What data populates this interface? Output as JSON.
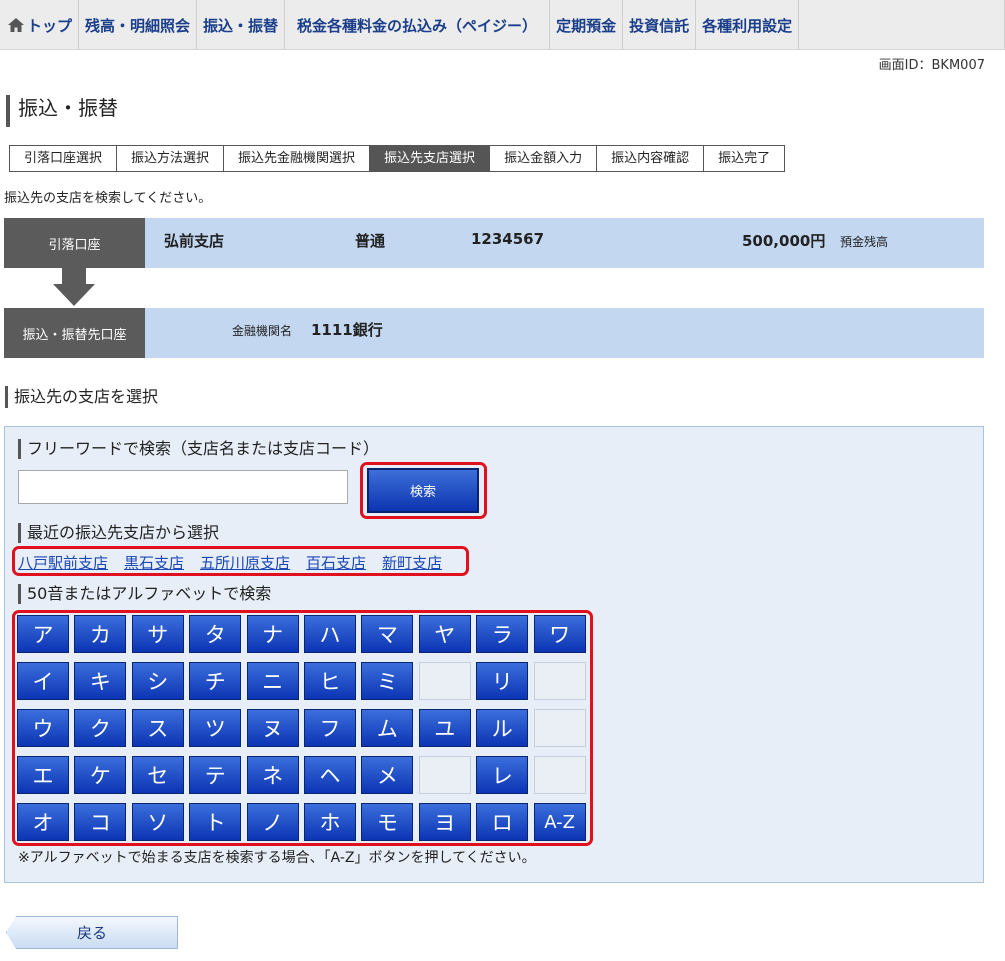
{
  "nav": {
    "items": [
      "トップ",
      "残高・明細照会",
      "振込・振替",
      "税金各種料金の払込み（ペイジー）",
      "定期預金",
      "投資信託",
      "各種利用設定"
    ]
  },
  "screen_id": "画面ID：BKM007",
  "page_title": "振込・振替",
  "steps": [
    "引落口座選択",
    "振込方法選択",
    "振込先金融機関選択",
    "振込先支店選択",
    "振込金額入力",
    "振込内容確認",
    "振込完了"
  ],
  "instruction": "振込先の支店を検索してください。",
  "debit_account": {
    "label": "引落口座",
    "branch": "弘前支店",
    "type": "普通",
    "number": "1234567",
    "balance": "500,000円",
    "balance_label": "預金残高"
  },
  "target_account": {
    "label": "振込・振替先口座",
    "bank_label": "金融機関名",
    "bank_name": "1111銀行"
  },
  "section_title": "振込先の支店を選択",
  "free_search": {
    "title": "フリーワードで検索（支店名または支店コード）",
    "value": "",
    "button": "検索"
  },
  "recent": {
    "title": "最近の振込先支店から選択",
    "branches": [
      "八戸駅前支店",
      "黒石支店",
      "五所川原支店",
      "百石支店",
      "新町支店"
    ]
  },
  "kana": {
    "title": "50音またはアルファベットで検索",
    "rows": [
      [
        "ア",
        "カ",
        "サ",
        "タ",
        "ナ",
        "ハ",
        "マ",
        "ヤ",
        "ラ",
        "ワ"
      ],
      [
        "イ",
        "キ",
        "シ",
        "チ",
        "ニ",
        "ヒ",
        "ミ",
        "",
        "リ",
        ""
      ],
      [
        "ウ",
        "ク",
        "ス",
        "ツ",
        "ヌ",
        "フ",
        "ム",
        "ユ",
        "ル",
        ""
      ],
      [
        "エ",
        "ケ",
        "セ",
        "テ",
        "ネ",
        "ヘ",
        "メ",
        "",
        "レ",
        ""
      ],
      [
        "オ",
        "コ",
        "ソ",
        "ト",
        "ノ",
        "ホ",
        "モ",
        "ヨ",
        "ロ",
        "A-Z"
      ]
    ],
    "note": "※アルファベットで始まる支店を検索する場合、「A-Z」ボタンを押してください。"
  },
  "back_button": "戻る"
}
